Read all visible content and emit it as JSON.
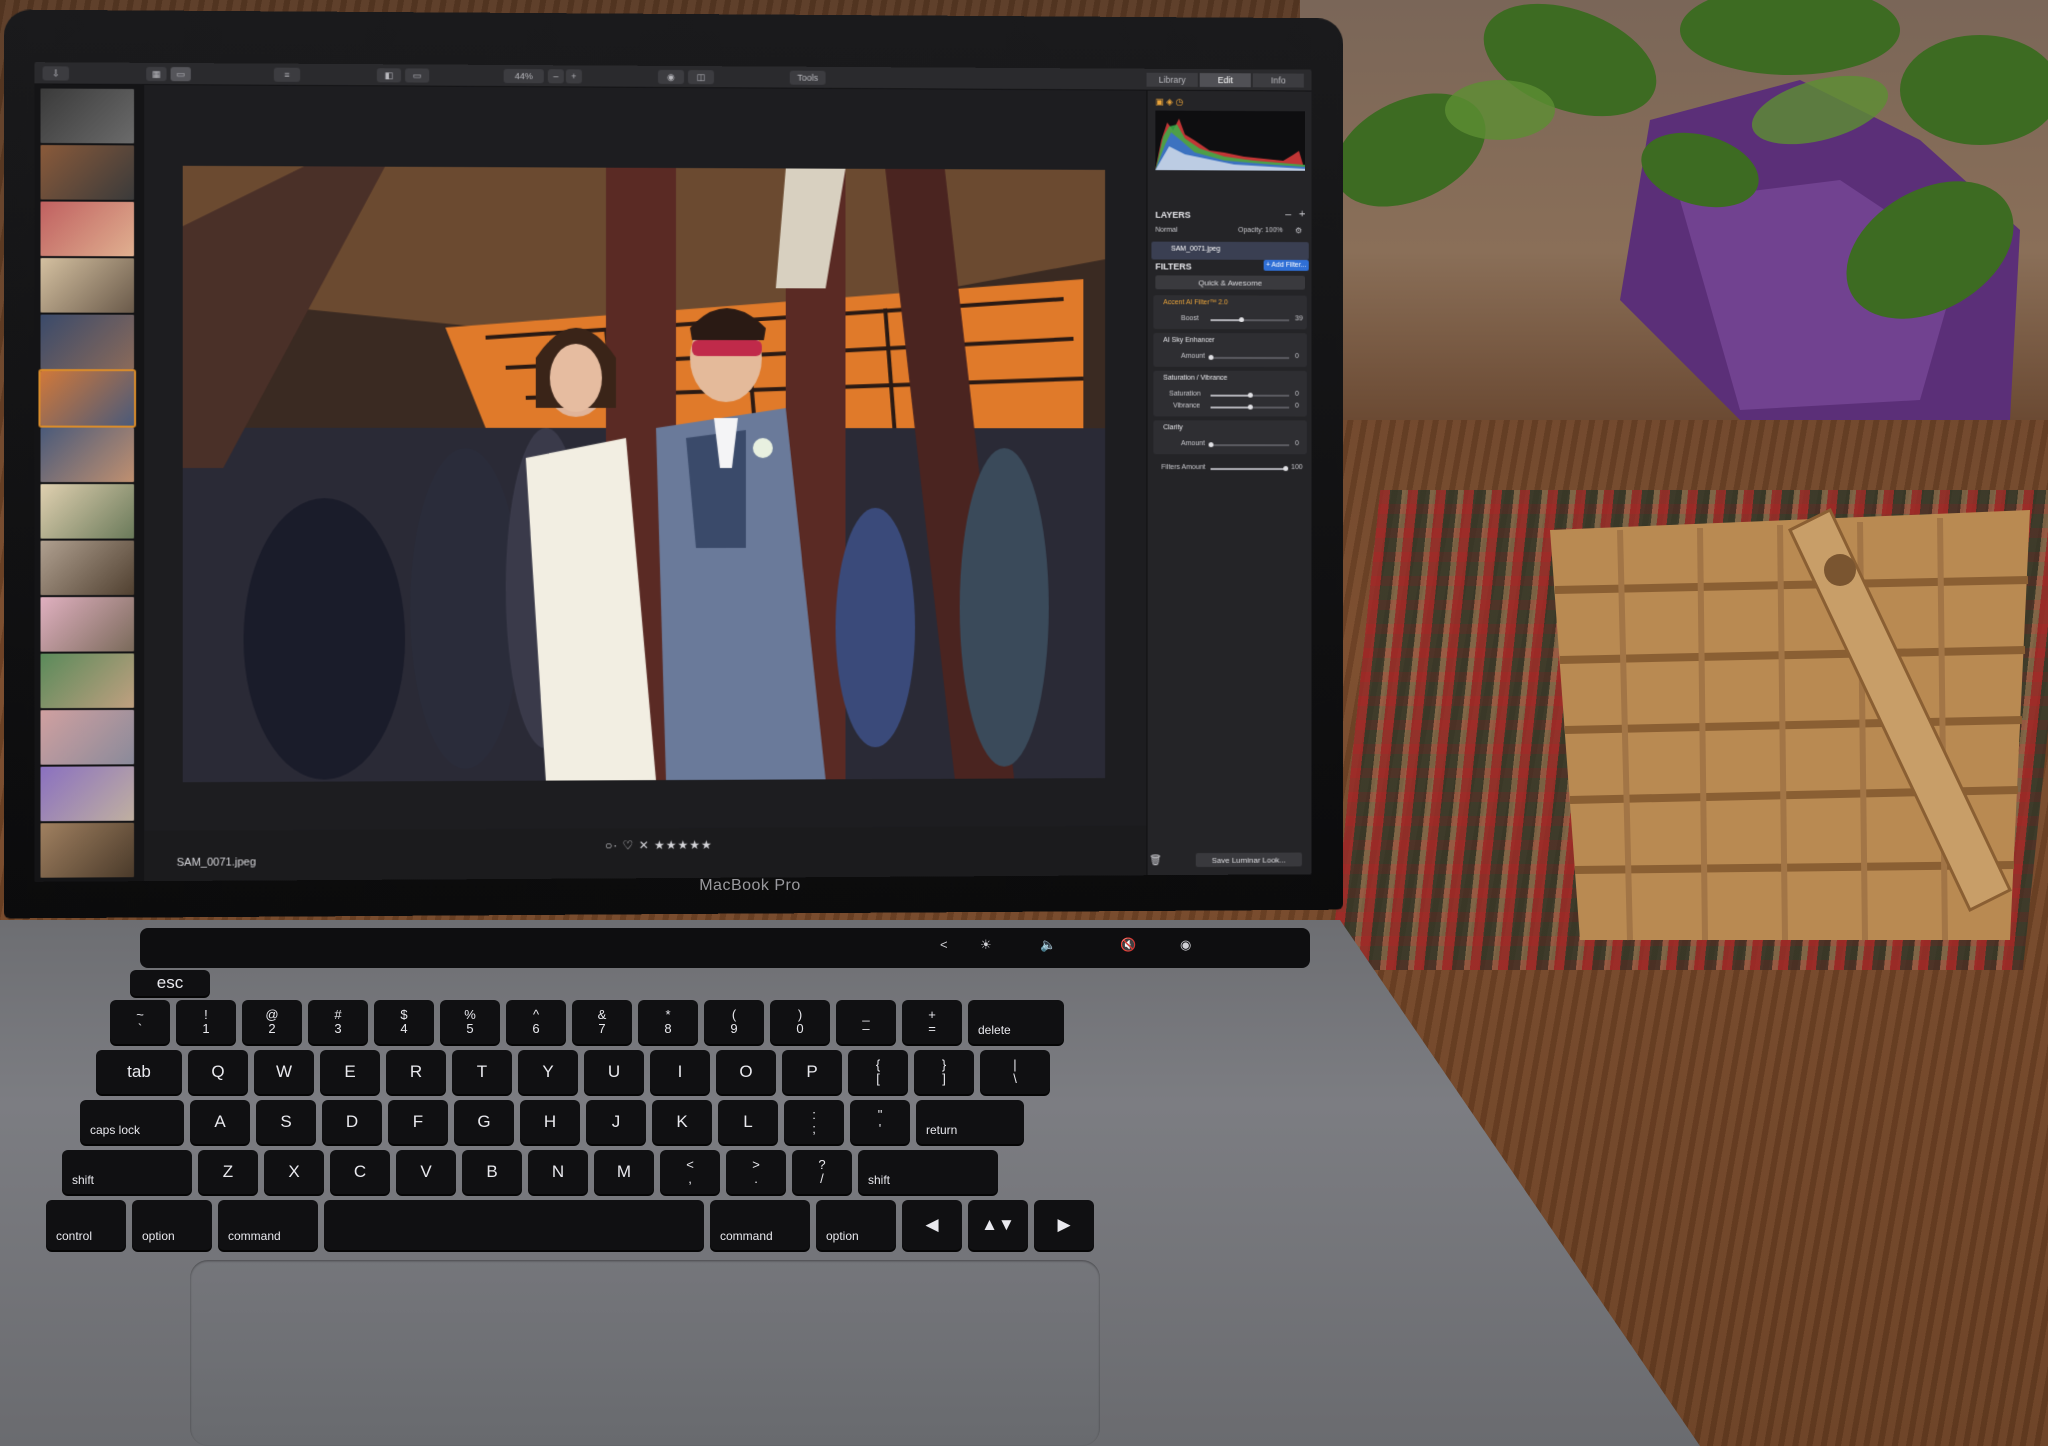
{
  "laptop": {
    "brand": "MacBook Pro",
    "touchbar": {
      "back": "<",
      "brightness": "☀",
      "volume": "🔈",
      "mute": "🔇",
      "siri": "◉"
    }
  },
  "app": {
    "toolbar": {
      "zoom": "44%",
      "zoom_out": "–",
      "zoom_in": "+",
      "tools": "Tools",
      "tabs": [
        "Library",
        "Edit",
        "Info"
      ],
      "active_tab": "Edit"
    },
    "viewer": {
      "filename": "SAM_0071.jpeg",
      "rating_bar": "○· ♡  ✕ ★★★★★"
    },
    "panel": {
      "layers_title": "LAYERS",
      "blend_mode": "Normal",
      "opacity": "Opacity: 100%",
      "layer_name": "SAM_0071.jpeg",
      "filters_title": "FILTERS",
      "add_filter": "+ Add Filter...",
      "preset": "Quick & Awesome",
      "filters": [
        {
          "name": "Accent AI Filter™ 2.0",
          "params": [
            {
              "label": "Boost",
              "value": "39",
              "level": 0.39
            }
          ]
        },
        {
          "name": "AI Sky Enhancer",
          "params": [
            {
              "label": "Amount",
              "value": "0",
              "level": 0
            }
          ]
        },
        {
          "name": "Saturation / Vibrance",
          "params": [
            {
              "label": "Saturation",
              "value": "0",
              "level": 0.5
            },
            {
              "label": "Vibrance",
              "value": "0",
              "level": 0.5
            }
          ]
        },
        {
          "name": "Clarity",
          "params": [
            {
              "label": "Amount",
              "value": "0",
              "level": 0
            }
          ]
        }
      ],
      "filters_amount": {
        "label": "Filters Amount",
        "value": "100",
        "level": 1.0
      },
      "save_look": "Save Luminar Look..."
    }
  },
  "keyboard": {
    "rows": [
      [
        "esc"
      ],
      [
        "~\n`",
        "!\n1",
        "@\n2",
        "#\n3",
        "$\n4",
        "%\n5",
        "^\n6",
        "&\n7",
        "*\n8",
        "(\n9",
        ")\n0",
        "_\n–",
        "+\n=",
        "delete"
      ],
      [
        "tab",
        "Q",
        "W",
        "E",
        "R",
        "T",
        "Y",
        "U",
        "I",
        "O",
        "P",
        "{\n[",
        "}\n]",
        "|\n\\"
      ],
      [
        "caps lock",
        "A",
        "S",
        "D",
        "F",
        "G",
        "H",
        "J",
        "K",
        "L",
        ":\n;",
        "\"\n'",
        "return"
      ],
      [
        "shift",
        "Z",
        "X",
        "C",
        "V",
        "B",
        "N",
        "M",
        "<\n,",
        ">\n.",
        "?\n/",
        "shift"
      ],
      [
        "control",
        "option",
        "command",
        "",
        "command",
        "option",
        "◀",
        "▲▼",
        "▶"
      ]
    ]
  },
  "colors": {
    "accent_orange": "#d98c2b",
    "add_filter_blue": "#2f6fd6",
    "filter_title_orange": "#e8a33a"
  }
}
